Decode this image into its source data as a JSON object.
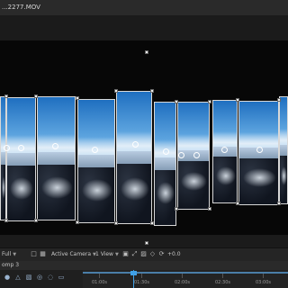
{
  "window": {
    "file_tab": "...2277.MOV"
  },
  "toolbar": {
    "resolution": "Full",
    "camera": "Active Camera",
    "views": "1 View",
    "exposure": "+0.0"
  },
  "timeline": {
    "comp_tab": "omp 3",
    "ruler_labels": [
      "01:00s",
      "01:30s",
      "02:00s",
      "02:30s",
      "03:00s"
    ]
  },
  "colors": {
    "accent": "#3fa0e6",
    "viewer_bg": "#070707",
    "panel_bg": "#252525"
  }
}
